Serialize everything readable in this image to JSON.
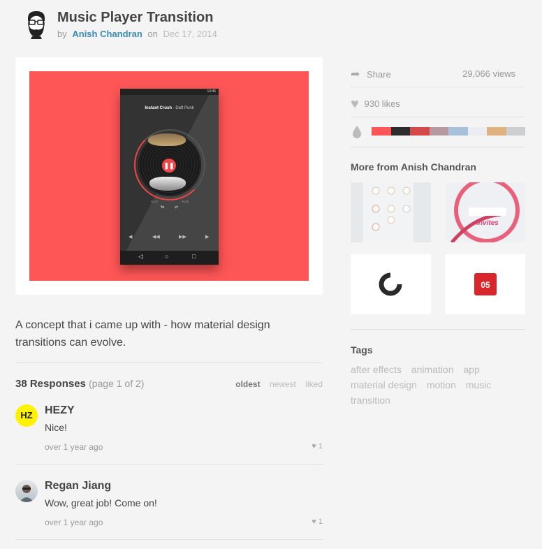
{
  "header": {
    "title": "Music Player Transition",
    "by_label": "by",
    "author": "Anish Chandran",
    "on_label": "on",
    "date": "Dec 17, 2014"
  },
  "shot": {
    "phone_status_time": "13:45",
    "track_title": "Instant Crush",
    "track_sep": " - ",
    "track_artist": "Daft Punk",
    "time_elapsed": "02:37",
    "time_total": "03:35"
  },
  "description": "A concept that i came up with - how material design transitions can evolve.",
  "responses": {
    "count_label": "38 Responses",
    "page_label": "(page 1 of 2)",
    "sort_options": [
      "oldest",
      "newest",
      "liked"
    ],
    "active_sort": "oldest",
    "comments": [
      {
        "avatar_text": "HZ",
        "name": "HEZY",
        "text": "Nice!",
        "time": "over 1 year ago",
        "likes": "1"
      },
      {
        "avatar_text": "",
        "name": "Regan Jiang",
        "text": "Wow, great job! Come on!",
        "time": "over 1 year ago",
        "likes": "1"
      }
    ]
  },
  "sidebar": {
    "share_label": "Share",
    "views": "29,066 views",
    "likes": "930 likes",
    "palette": [
      "#fe5656",
      "#2d2d2d",
      "#d44a4a",
      "#b79a9f",
      "#a9c0dc",
      "#ecedf0",
      "#dfb37f",
      "#ccd0d0"
    ],
    "more_from": "More from Anish Chandran",
    "thumb_invites_label": "invites",
    "thumb_badge_label": "05",
    "tags_title": "Tags",
    "tags": [
      "after effects",
      "animation",
      "app",
      "material design",
      "motion",
      "music",
      "transition"
    ]
  }
}
